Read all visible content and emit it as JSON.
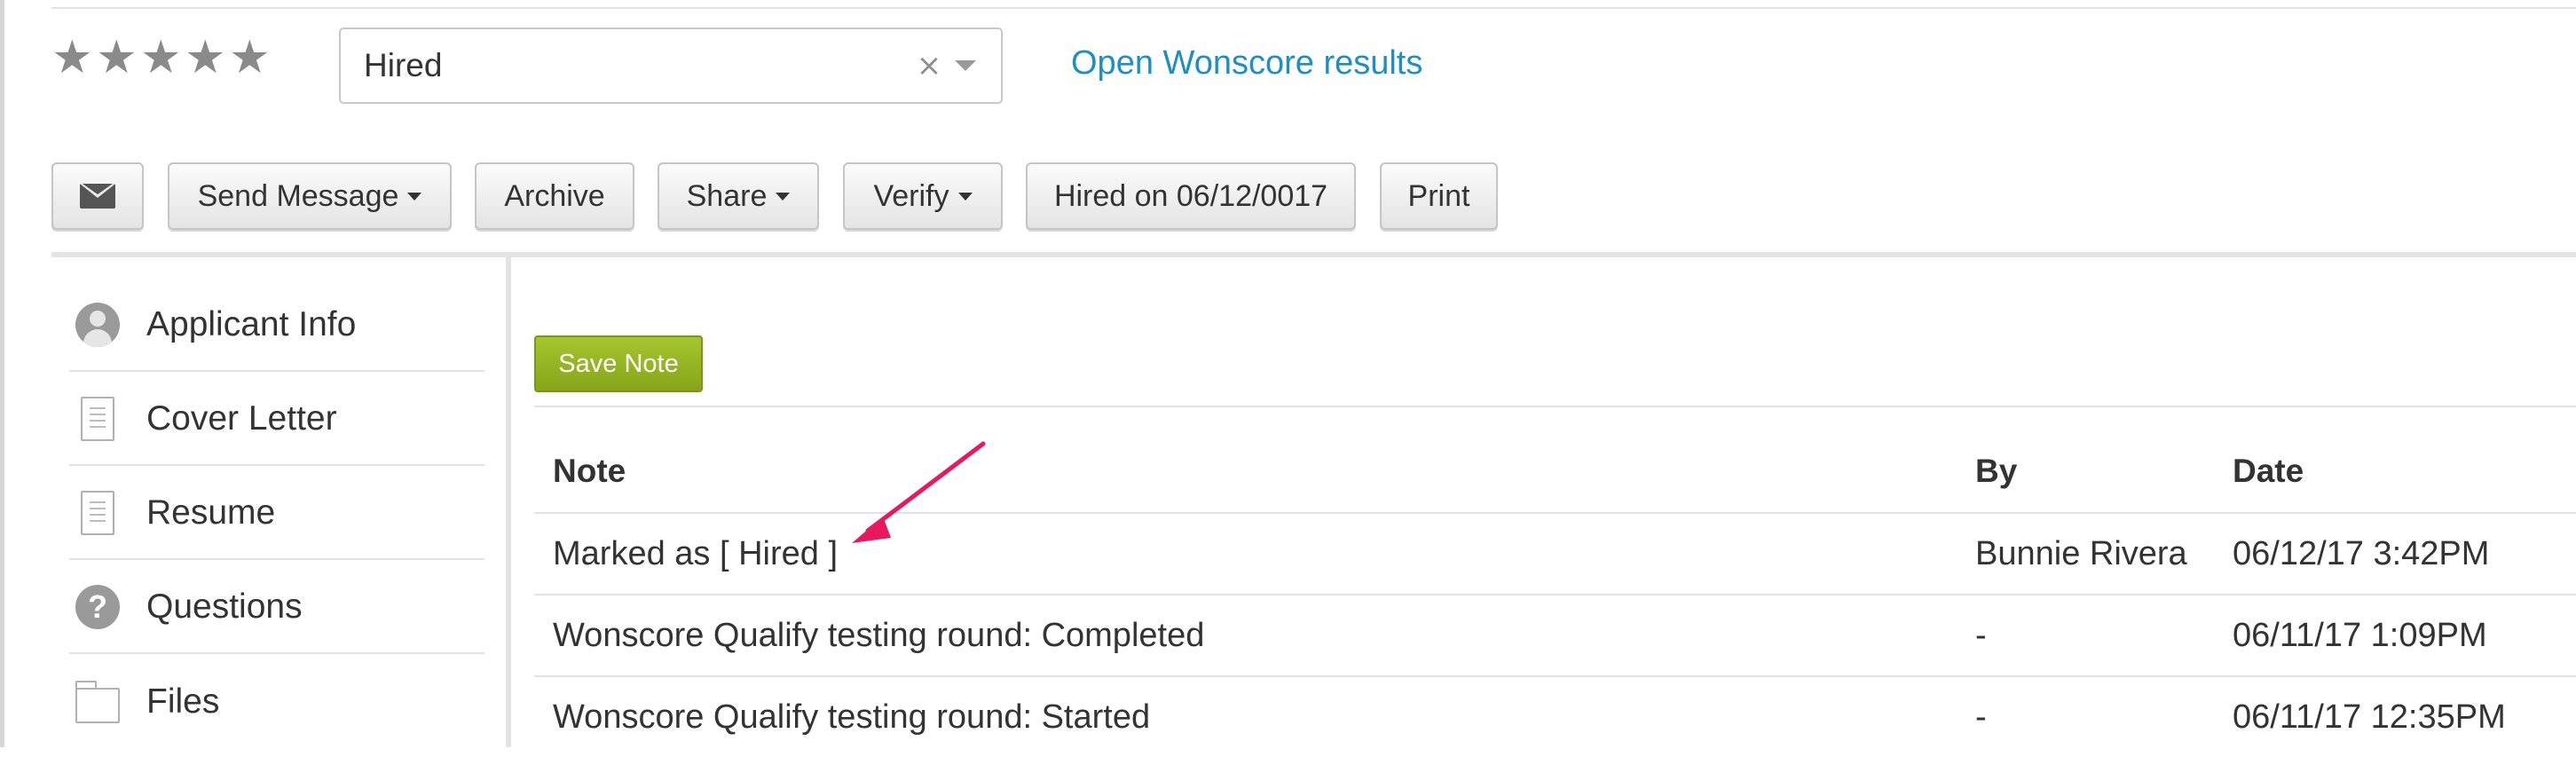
{
  "rating": {
    "stars": [
      "★",
      "★",
      "★",
      "★",
      "★"
    ]
  },
  "status": {
    "value": "Hired",
    "clear_symbol": "×"
  },
  "links": {
    "open_wonscore": "Open Wonscore results"
  },
  "toolbar": {
    "send_message": "Send Message",
    "archive": "Archive",
    "share": "Share",
    "verify": "Verify",
    "hired_on": "Hired on 06/12/0017",
    "print": "Print"
  },
  "sidebar": {
    "items": [
      {
        "label": "Applicant Info",
        "icon": "person-icon"
      },
      {
        "label": "Cover Letter",
        "icon": "document-icon"
      },
      {
        "label": "Resume",
        "icon": "document-icon"
      },
      {
        "label": "Questions",
        "icon": "question-icon"
      },
      {
        "label": "Files",
        "icon": "folder-icon"
      }
    ]
  },
  "notes": {
    "save_label": "Save Note",
    "columns": {
      "note": "Note",
      "by": "By",
      "date": "Date"
    },
    "rows": [
      {
        "note": "Marked as [ Hired ]",
        "by": "Bunnie Rivera",
        "date": "06/12/17 3:42PM"
      },
      {
        "note": "Wonscore Qualify testing round: Completed",
        "by": "-",
        "date": "06/11/17 1:09PM"
      },
      {
        "note": "Wonscore Qualify testing round: Started",
        "by": "-",
        "date": "06/11/17 12:35PM"
      }
    ]
  },
  "colors": {
    "link": "#1c8fc4",
    "save_button": "#98b824",
    "arrow": "#e8185f",
    "star": "#8a8a8a"
  }
}
